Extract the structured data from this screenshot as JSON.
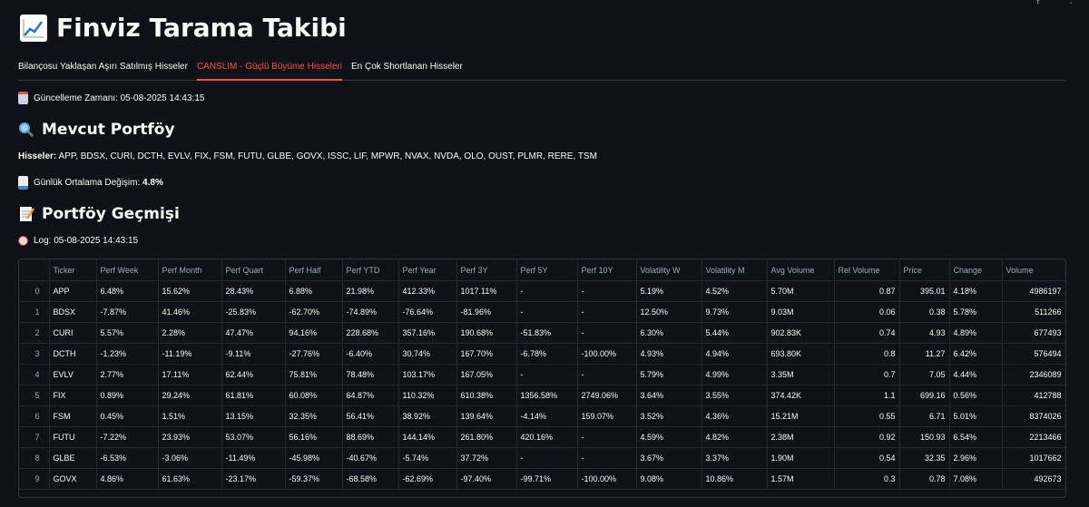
{
  "title": "Finviz Tarama Takibi",
  "tabs": [
    {
      "label": "Bilançosu Yaklaşan Aşırı Satılmış Hisseler",
      "active": false
    },
    {
      "label": "CANSLIM - Güçlü Büyüme Hisseleri",
      "active": true
    },
    {
      "label": "En Çok Shortlanan Hisseler",
      "active": false
    }
  ],
  "update_time": "Güncelleme Zamanı: 05-08-2025 14:43:15",
  "current_portfolio": {
    "heading": "Mevcut Portföy",
    "stocks_label": "Hisseler:",
    "stocks_value": " APP, BDSX, CURI, DCTH, EVLV, FIX, FSM, FUTU, GLBE, GOVX, ISSC, LIF, MPWR, NVAX, NVDA, OLO, OUST, PLMR, RERE, TSM",
    "avg_change_label": "Günlük Ortalama Değişim: ",
    "avg_change_value": "4.8%"
  },
  "history": {
    "heading": "Portföy Geçmişi",
    "log": "Log: 05-08-2025 14:43:15"
  },
  "table": {
    "columns": [
      "",
      "Ticker",
      "Perf Week",
      "Perf Month",
      "Perf Quart",
      "Perf Half",
      "Perf YTD",
      "Perf Year",
      "Perf 3Y",
      "Perf 5Y",
      "Perf 10Y",
      "Volatility W",
      "Volatility M",
      "Avg Volume",
      "Rel Volume",
      "Price",
      "Change",
      "Volume"
    ],
    "rows": [
      [
        "0",
        "APP",
        "6.48%",
        "15.62%",
        "28.43%",
        "6.88%",
        "21.98%",
        "412.33%",
        "1017.11%",
        "-",
        "-",
        "5.19%",
        "4.52%",
        "5.70M",
        "0.87",
        "395.01",
        "4.18%",
        "4986197"
      ],
      [
        "1",
        "BDSX",
        "-7.87%",
        "41.46%",
        "-25.83%",
        "-62.70%",
        "-74.89%",
        "-76.64%",
        "-81.96%",
        "-",
        "-",
        "12.50%",
        "9.73%",
        "9.03M",
        "0.06",
        "0.38",
        "5.78%",
        "511266"
      ],
      [
        "2",
        "CURI",
        "5.57%",
        "2.28%",
        "47.47%",
        "94.16%",
        "228.68%",
        "357.16%",
        "190.68%",
        "-51.83%",
        "-",
        "6.30%",
        "5.44%",
        "902.83K",
        "0.74",
        "4.93",
        "4.89%",
        "677493"
      ],
      [
        "3",
        "DCTH",
        "-1.23%",
        "-11.19%",
        "-9.11%",
        "-27.76%",
        "-6.40%",
        "30.74%",
        "167.70%",
        "-6.78%",
        "-100.00%",
        "4.93%",
        "4.94%",
        "693.80K",
        "0.8",
        "11.27",
        "6.42%",
        "576494"
      ],
      [
        "4",
        "EVLV",
        "2.77%",
        "17.11%",
        "62.44%",
        "75.81%",
        "78.48%",
        "103.17%",
        "167.05%",
        "-",
        "-",
        "5.79%",
        "4.99%",
        "3.35M",
        "0.7",
        "7.05",
        "4.44%",
        "2346089"
      ],
      [
        "5",
        "FIX",
        "0.89%",
        "29.24%",
        "61.81%",
        "60.08%",
        "64.87%",
        "110.32%",
        "610.38%",
        "1356.58%",
        "2749.06%",
        "3.64%",
        "3.55%",
        "374.42K",
        "1.1",
        "699.16",
        "0.56%",
        "412788"
      ],
      [
        "6",
        "FSM",
        "0.45%",
        "1.51%",
        "13.15%",
        "32.35%",
        "56.41%",
        "38.92%",
        "139.64%",
        "-4.14%",
        "159.07%",
        "3.52%",
        "4.36%",
        "15.21M",
        "0.55",
        "6.71",
        "5.01%",
        "8374026"
      ],
      [
        "7",
        "FUTU",
        "-7.22%",
        "23.93%",
        "53.07%",
        "56.16%",
        "88.69%",
        "144.14%",
        "261.80%",
        "420.16%",
        "-",
        "4.59%",
        "4.82%",
        "2.38M",
        "0.92",
        "150.93",
        "6.54%",
        "2213466"
      ],
      [
        "8",
        "GLBE",
        "-6.53%",
        "-3.06%",
        "-11.49%",
        "-45.98%",
        "-40.67%",
        "-5.74%",
        "37.72%",
        "-",
        "-",
        "3.67%",
        "3.37%",
        "1.90M",
        "0.54",
        "32.35",
        "2.96%",
        "1017662"
      ],
      [
        "9",
        "GOVX",
        "4.86%",
        "61.63%",
        "-23.17%",
        "-59.37%",
        "-68.58%",
        "-62.69%",
        "-97.40%",
        "-99.71%",
        "-100.00%",
        "9.08%",
        "10.86%",
        "1.57M",
        "0.3",
        "0.78",
        "7.08%",
        "492673"
      ]
    ]
  },
  "colors": {
    "background": "#0e1117",
    "accent": "#ff4b4b",
    "border": "#31333f"
  }
}
